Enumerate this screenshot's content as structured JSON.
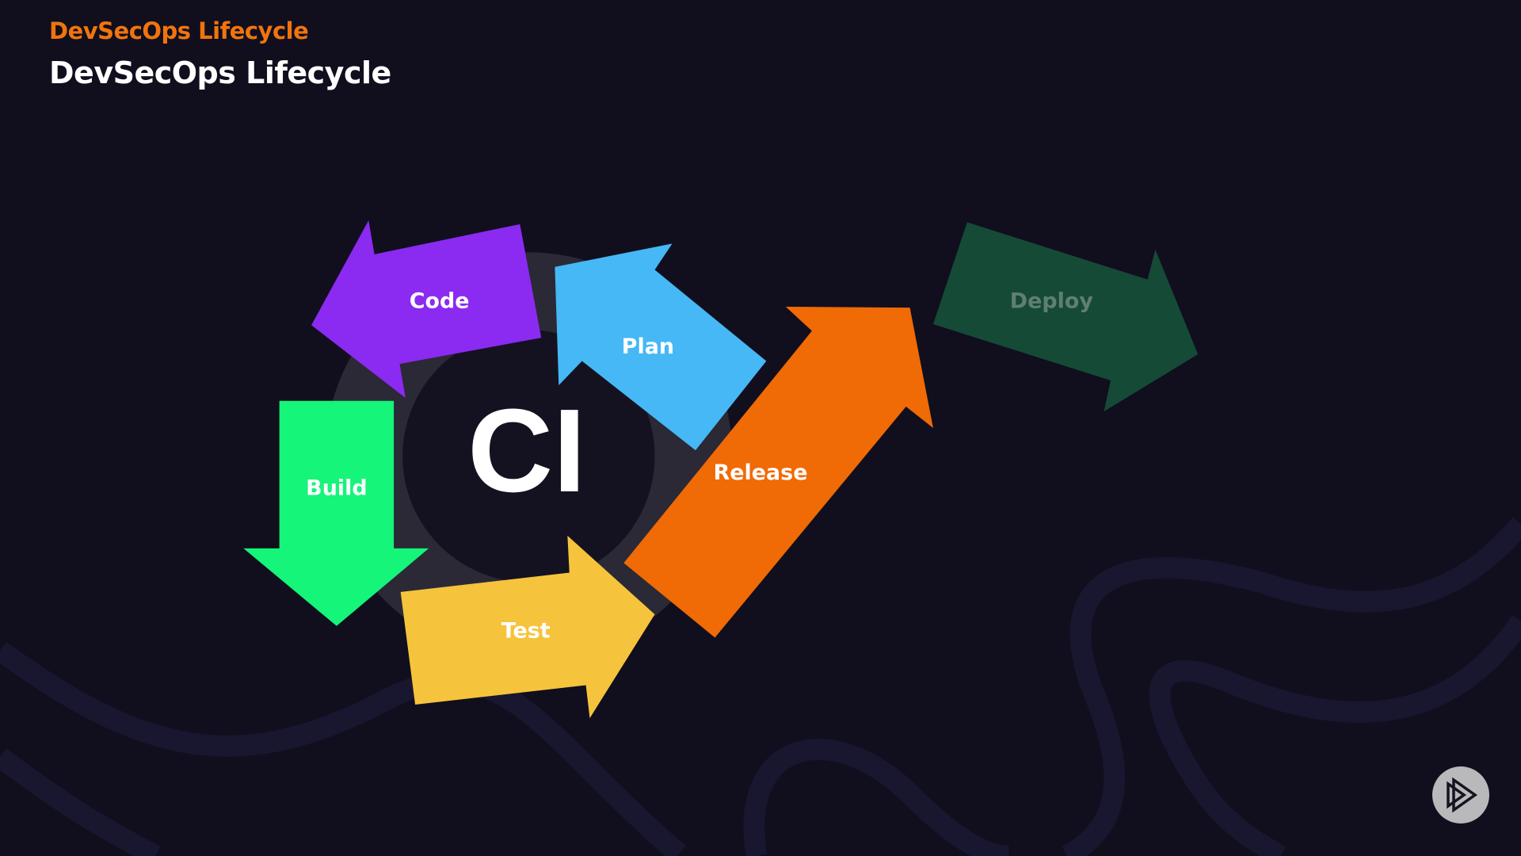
{
  "header": {
    "section_label": "DevSecOps Lifecycle",
    "title": "DevSecOps Lifecycle"
  },
  "diagram": {
    "center_label": "CI",
    "stages": {
      "code": "Code",
      "plan": "Plan",
      "build": "Build",
      "test": "Test",
      "release": "Release",
      "deploy": "Deploy"
    },
    "colors": {
      "code": "#8b2af0",
      "plan": "#45b8f5",
      "build": "#14f57a",
      "test": "#f5c43c",
      "release": "#f06a05",
      "deploy": "#154a36"
    }
  },
  "controls": {
    "play_icon": "play-logo-icon"
  }
}
